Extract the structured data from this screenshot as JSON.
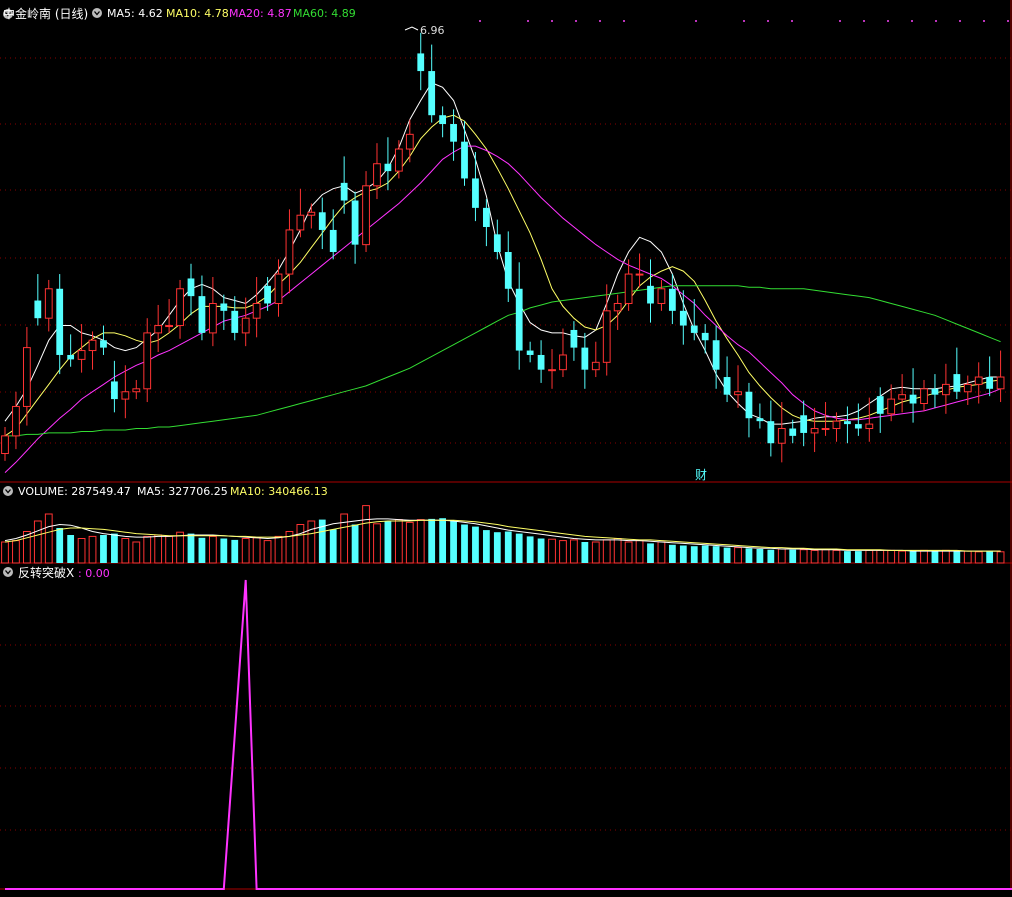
{
  "header": {
    "stock_title": "中金岭南 (日线)",
    "ma_indicators": [
      {
        "label": "MA5: 4.62",
        "color": "#ffffff"
      },
      {
        "label": "MA10: 4.78",
        "color": "#ffff66"
      },
      {
        "label": "MA20: 4.87",
        "color": "#ff33ff"
      },
      {
        "label": "MA60: 4.89",
        "color": "#33dd33"
      }
    ]
  },
  "volume_panel": {
    "indicators": [
      {
        "label": "VOLUME: 287549.47",
        "color": "#ffffff"
      },
      {
        "label": "MA5: 327706.25",
        "color": "#ffffff"
      },
      {
        "label": "MA10: 340466.13",
        "color": "#ffff66"
      }
    ]
  },
  "signal_panel": {
    "name": "反转突破X",
    "value": ": 0.00",
    "color": "#ff33ff"
  },
  "annotations": {
    "peak_label": "6.96",
    "finance_marker": "财"
  },
  "colors": {
    "up": "#ff3333",
    "down": "#55ffff",
    "frame": "#aa0000",
    "grid": "#880000",
    "ma5": "#ffffff",
    "ma10": "#ffff66",
    "ma20": "#ff33ff",
    "ma60": "#33dd33",
    "signal": "#ff33ff"
  },
  "chart_data": [
    {
      "type": "candlestick",
      "ylim": [
        4.0,
        7.1
      ],
      "series": [
        {
          "name": "MA5",
          "values": [
            4.4,
            4.5,
            4.62,
            4.78,
            4.95,
            5.05,
            5.05,
            5.0,
            4.98,
            4.95,
            4.9,
            4.88,
            4.9,
            4.96,
            5.02,
            5.12,
            5.22,
            5.3,
            5.33,
            5.3,
            5.24,
            5.22,
            5.2,
            5.26,
            5.34,
            5.43,
            5.56,
            5.7,
            5.86,
            5.94,
            5.98,
            6.0,
            5.95,
            5.98,
            6.03,
            6.12,
            6.26,
            6.45,
            6.58,
            6.7,
            6.67,
            6.58,
            6.38,
            6.18,
            5.93,
            5.6,
            5.35,
            5.2,
            5.07,
            5.02,
            5.0,
            5.0,
            4.98,
            4.97,
            5.02,
            5.2,
            5.4,
            5.55,
            5.65,
            5.62,
            5.55,
            5.4,
            5.2,
            5.02,
            4.88,
            4.72,
            4.6,
            4.52,
            4.45,
            4.42,
            4.38,
            4.38,
            4.39,
            4.4,
            4.42,
            4.43,
            4.43,
            4.44,
            4.47,
            4.52,
            4.57,
            4.62,
            4.63,
            4.62,
            4.62,
            4.62,
            4.63,
            4.64,
            4.66,
            4.68,
            4.7,
            4.7
          ]
        },
        {
          "name": "MA10",
          "values": [
            4.3,
            4.35,
            4.45,
            4.55,
            4.65,
            4.75,
            4.84,
            4.9,
            4.96,
            5.0,
            5.0,
            4.98,
            4.95,
            4.93,
            4.95,
            5.0,
            5.06,
            5.13,
            5.18,
            5.18,
            5.18,
            5.17,
            5.17,
            5.2,
            5.25,
            5.33,
            5.4,
            5.48,
            5.58,
            5.68,
            5.78,
            5.87,
            5.92,
            5.96,
            5.98,
            6.02,
            6.1,
            6.2,
            6.32,
            6.4,
            6.46,
            6.48,
            6.44,
            6.35,
            6.25,
            6.12,
            5.98,
            5.83,
            5.68,
            5.5,
            5.3,
            5.18,
            5.1,
            5.04,
            5.02,
            5.05,
            5.12,
            5.22,
            5.32,
            5.38,
            5.42,
            5.45,
            5.42,
            5.35,
            5.22,
            5.08,
            4.96,
            4.85,
            4.73,
            4.64,
            4.56,
            4.49,
            4.44,
            4.41,
            4.4,
            4.4,
            4.4,
            4.41,
            4.42,
            4.44,
            4.47,
            4.5,
            4.53,
            4.55,
            4.57,
            4.59,
            4.61,
            4.63,
            4.64,
            4.65,
            4.67,
            4.68
          ]
        },
        {
          "name": "MA20",
          "values": [
            4.05,
            4.12,
            4.2,
            4.28,
            4.35,
            4.42,
            4.48,
            4.55,
            4.6,
            4.65,
            4.7,
            4.74,
            4.78,
            4.81,
            4.85,
            4.88,
            4.92,
            4.96,
            5.0,
            5.04,
            5.08,
            5.1,
            5.12,
            5.15,
            5.18,
            5.22,
            5.28,
            5.34,
            5.4,
            5.46,
            5.52,
            5.58,
            5.64,
            5.7,
            5.76,
            5.82,
            5.88,
            5.95,
            6.02,
            6.1,
            6.18,
            6.23,
            6.27,
            6.27,
            6.24,
            6.2,
            6.15,
            6.08,
            6.0,
            5.92,
            5.85,
            5.78,
            5.72,
            5.66,
            5.6,
            5.55,
            5.5,
            5.46,
            5.43,
            5.4,
            5.37,
            5.32,
            5.26,
            5.2,
            5.12,
            5.05,
            4.98,
            4.92,
            4.87,
            4.8,
            4.73,
            4.66,
            4.58,
            4.52,
            4.47,
            4.44,
            4.42,
            4.41,
            4.41,
            4.42,
            4.43,
            4.44,
            4.45,
            4.46,
            4.47,
            4.49,
            4.51,
            4.53,
            4.55,
            4.57,
            4.59,
            4.62
          ]
        },
        {
          "name": "MA60",
          "values": [
            4.3,
            4.3,
            4.31,
            4.31,
            4.32,
            4.32,
            4.32,
            4.33,
            4.33,
            4.34,
            4.34,
            4.34,
            4.35,
            4.35,
            4.36,
            4.36,
            4.37,
            4.38,
            4.39,
            4.4,
            4.41,
            4.42,
            4.43,
            4.44,
            4.46,
            4.48,
            4.5,
            4.52,
            4.54,
            4.56,
            4.58,
            4.6,
            4.62,
            4.64,
            4.67,
            4.7,
            4.73,
            4.76,
            4.8,
            4.84,
            4.88,
            4.92,
            4.96,
            5.0,
            5.04,
            5.08,
            5.12,
            5.14,
            5.17,
            5.19,
            5.21,
            5.22,
            5.23,
            5.24,
            5.25,
            5.26,
            5.27,
            5.28,
            5.29,
            5.3,
            5.31,
            5.32,
            5.32,
            5.32,
            5.32,
            5.32,
            5.32,
            5.32,
            5.31,
            5.31,
            5.3,
            5.3,
            5.3,
            5.3,
            5.29,
            5.28,
            5.27,
            5.26,
            5.25,
            5.24,
            5.22,
            5.2,
            5.18,
            5.16,
            5.14,
            5.12,
            5.09,
            5.06,
            5.03,
            5.0,
            4.97,
            4.94
          ]
        }
      ],
      "closes": [
        4.3,
        4.5,
        4.9,
        5.1,
        5.3,
        4.85,
        4.82,
        4.88,
        4.95,
        4.9,
        4.55,
        4.6,
        4.62,
        5.0,
        5.05,
        5.05,
        5.3,
        5.25,
        5.0,
        5.2,
        5.15,
        5.0,
        5.1,
        5.2,
        5.2,
        5.4,
        5.7,
        5.8,
        5.82,
        5.7,
        5.55,
        5.9,
        5.6,
        6.0,
        6.15,
        6.1,
        6.25,
        6.35,
        6.78,
        6.48,
        6.42,
        6.3,
        6.05,
        5.85,
        5.72,
        5.55,
        5.3,
        4.88,
        4.85,
        4.75,
        4.75,
        4.85,
        4.9,
        4.75,
        4.8,
        5.15,
        5.2,
        5.4,
        5.4,
        5.2,
        5.3,
        5.15,
        5.05,
        5.0,
        4.95,
        4.75,
        4.58,
        4.6,
        4.42,
        4.4,
        4.25,
        4.35,
        4.3,
        4.32,
        4.35,
        4.35,
        4.4,
        4.38,
        4.35,
        4.38,
        4.45,
        4.55,
        4.58,
        4.52,
        4.62,
        4.58,
        4.65,
        4.6,
        4.65,
        4.7,
        4.62,
        4.7
      ],
      "annotation_peak": "6.96"
    },
    {
      "type": "bar",
      "name": "VOLUME",
      "values": [
        30,
        32,
        45,
        60,
        70,
        50,
        40,
        35,
        38,
        40,
        42,
        35,
        30,
        38,
        40,
        38,
        44,
        42,
        36,
        38,
        35,
        33,
        35,
        36,
        32,
        38,
        45,
        55,
        60,
        62,
        48,
        70,
        55,
        82,
        56,
        60,
        62,
        58,
        62,
        63,
        64,
        60,
        55,
        52,
        47,
        44,
        45,
        42,
        38,
        35,
        34,
        32,
        33,
        30,
        30,
        33,
        35,
        30,
        32,
        28,
        30,
        26,
        25,
        24,
        25,
        24,
        22,
        22,
        21,
        20,
        19,
        20,
        19,
        19,
        18,
        19,
        18,
        17,
        17,
        18,
        18,
        18,
        17,
        17,
        18,
        17,
        18,
        17,
        17,
        16,
        17,
        16
      ],
      "ma5": [
        32,
        35,
        40,
        46,
        52,
        55,
        54,
        50,
        45,
        42,
        40,
        38,
        37,
        37,
        38,
        38,
        39,
        40,
        40,
        40,
        39,
        38,
        37,
        36,
        35,
        36,
        38,
        42,
        48,
        52,
        56,
        58,
        60,
        62,
        63,
        63,
        62,
        61,
        61,
        61,
        61,
        60,
        58,
        56,
        53,
        50,
        47,
        45,
        43,
        41,
        39,
        37,
        35,
        34,
        33,
        33,
        33,
        32,
        32,
        31,
        30,
        29,
        28,
        27,
        26,
        25,
        24,
        23,
        22,
        21,
        21,
        20,
        20,
        20,
        19,
        19,
        19,
        18,
        18,
        18,
        18,
        18,
        18,
        17,
        17,
        17,
        17,
        17,
        17,
        17,
        17,
        17
      ],
      "ma10": [
        30,
        32,
        36,
        40,
        44,
        48,
        50,
        50,
        49,
        48,
        46,
        44,
        42,
        41,
        40,
        39,
        39,
        39,
        39,
        39,
        39,
        38,
        38,
        37,
        37,
        37,
        38,
        40,
        42,
        45,
        48,
        51,
        54,
        57,
        59,
        60,
        60,
        60,
        61,
        61,
        61,
        61,
        60,
        59,
        57,
        55,
        52,
        50,
        48,
        46,
        44,
        42,
        40,
        38,
        37,
        36,
        35,
        34,
        33,
        33,
        32,
        31,
        30,
        29,
        28,
        27,
        26,
        25,
        24,
        23,
        22,
        22,
        21,
        21,
        20,
        20,
        20,
        19,
        19,
        19,
        19,
        18,
        18,
        18,
        18,
        18,
        18,
        18,
        17,
        17,
        17,
        17
      ]
    },
    {
      "type": "line",
      "name": "反转突破X",
      "ylim": [
        0,
        1
      ],
      "x": [
        0,
        20,
        21,
        22,
        23,
        91
      ],
      "values": [
        0,
        0,
        0.5,
        1,
        0,
        0
      ]
    }
  ]
}
